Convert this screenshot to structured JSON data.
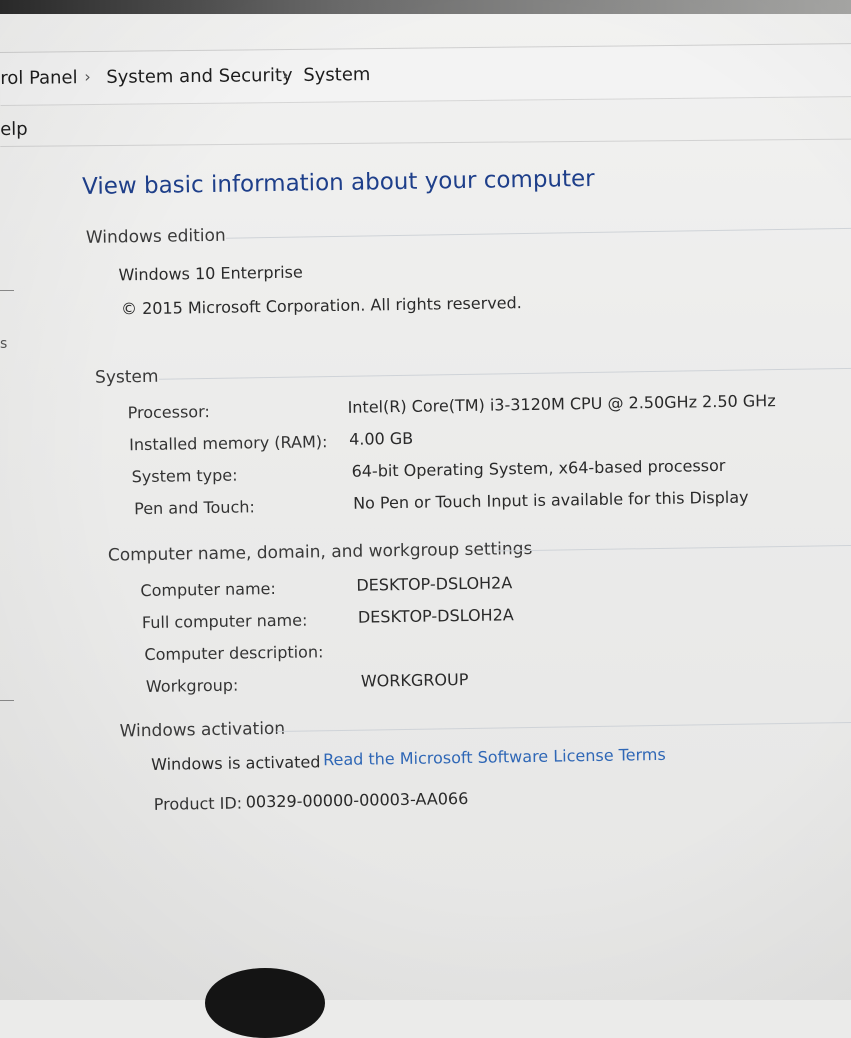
{
  "breadcrumb": {
    "items": [
      "rol Panel",
      "System and Security",
      "System"
    ],
    "separator": "›"
  },
  "menu": {
    "help": "elp"
  },
  "page": {
    "title": "View basic information about your computer"
  },
  "windows_edition": {
    "heading": "Windows edition",
    "edition": "Windows 10 Enterprise",
    "copyright": "© 2015 Microsoft Corporation. All rights reserved."
  },
  "system": {
    "heading": "System",
    "rows": [
      {
        "label": "Processor:",
        "value": "Intel(R) Core(TM) i3-3120M CPU @ 2.50GHz  2.50 GHz"
      },
      {
        "label": "Installed memory (RAM):",
        "value": "4.00 GB"
      },
      {
        "label": "System type:",
        "value": "64-bit Operating System, x64-based processor"
      },
      {
        "label": "Pen and Touch:",
        "value": "No Pen or Touch Input is available for this Display"
      }
    ]
  },
  "computer_name": {
    "heading": "Computer name, domain, and workgroup settings",
    "rows": [
      {
        "label": "Computer name:",
        "value": "DESKTOP-DSLOH2A"
      },
      {
        "label": "Full computer name:",
        "value": "DESKTOP-DSLOH2A"
      },
      {
        "label": "Computer description:",
        "value": ""
      },
      {
        "label": "Workgroup:",
        "value": "WORKGROUP"
      }
    ]
  },
  "activation": {
    "heading": "Windows activation",
    "status": "Windows is activated",
    "license_link": "Read the Microsoft Software License Terms",
    "product_id_label": "Product ID:",
    "product_id": "00329-00000-00003-AA066"
  },
  "sidebar": {
    "fragment": "s"
  },
  "colors": {
    "title": "#1e3f8a",
    "link": "#2f67b6",
    "rule": "#cfd3d8"
  }
}
